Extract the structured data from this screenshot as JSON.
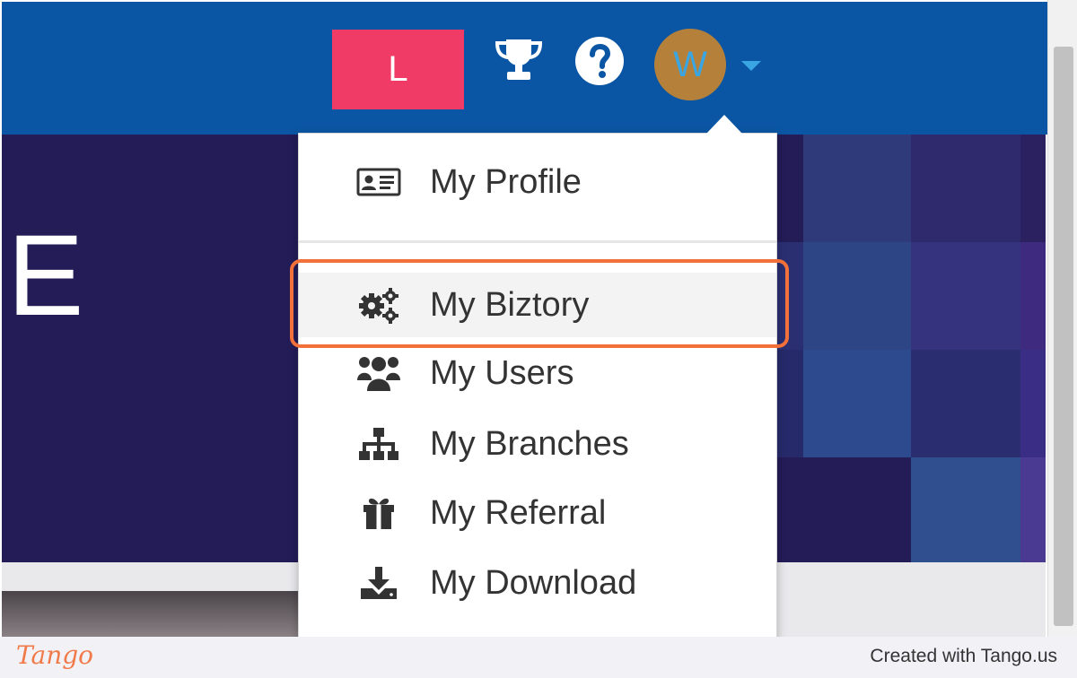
{
  "header": {
    "workspace_initial": "L",
    "avatar_initial": "W"
  },
  "hero": {
    "visible_text": "E"
  },
  "dropdown": {
    "items": [
      {
        "label": "My Profile",
        "icon": "id-card-icon"
      },
      {
        "label": "My Biztory",
        "icon": "gears-icon",
        "hovered": true
      },
      {
        "label": "My Users",
        "icon": "users-icon"
      },
      {
        "label": "My Branches",
        "icon": "sitemap-icon"
      },
      {
        "label": "My Referral",
        "icon": "gift-icon"
      },
      {
        "label": "My Download",
        "icon": "download-icon"
      }
    ]
  },
  "footer": {
    "logo": "Tango",
    "credit": "Created with Tango.us"
  },
  "colors": {
    "header_bg": "#0b56a4",
    "workspace_button": "#ef3b66",
    "avatar_bg": "#b5813a",
    "avatar_text": "#39a5e3",
    "hero_bg": "#231c57",
    "highlight": "#f2703a"
  }
}
